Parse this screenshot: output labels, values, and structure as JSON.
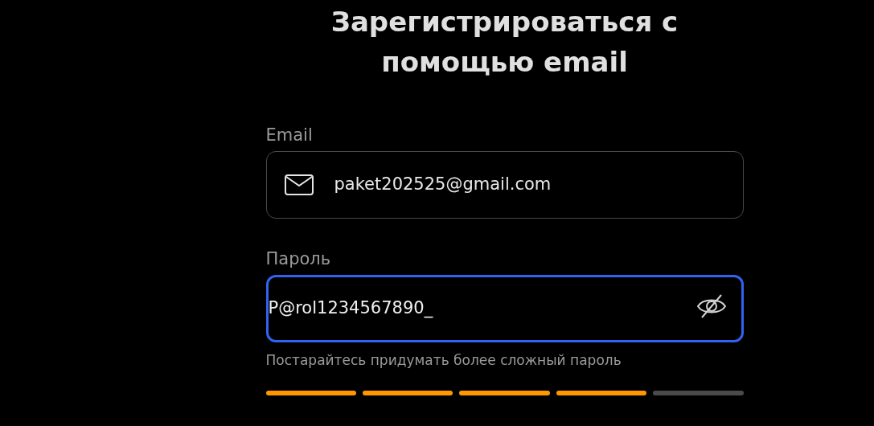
{
  "title": "Зарегистрироваться с помощью email",
  "email": {
    "label": "Email",
    "value": "paket202525@gmail.com",
    "focused": false
  },
  "password": {
    "label": "Пароль",
    "value": "P@rol1234567890_",
    "focused": true,
    "masked": false
  },
  "hint": "Постарайтесь придумать более сложный пароль",
  "strength": {
    "level": 0.8
  }
}
